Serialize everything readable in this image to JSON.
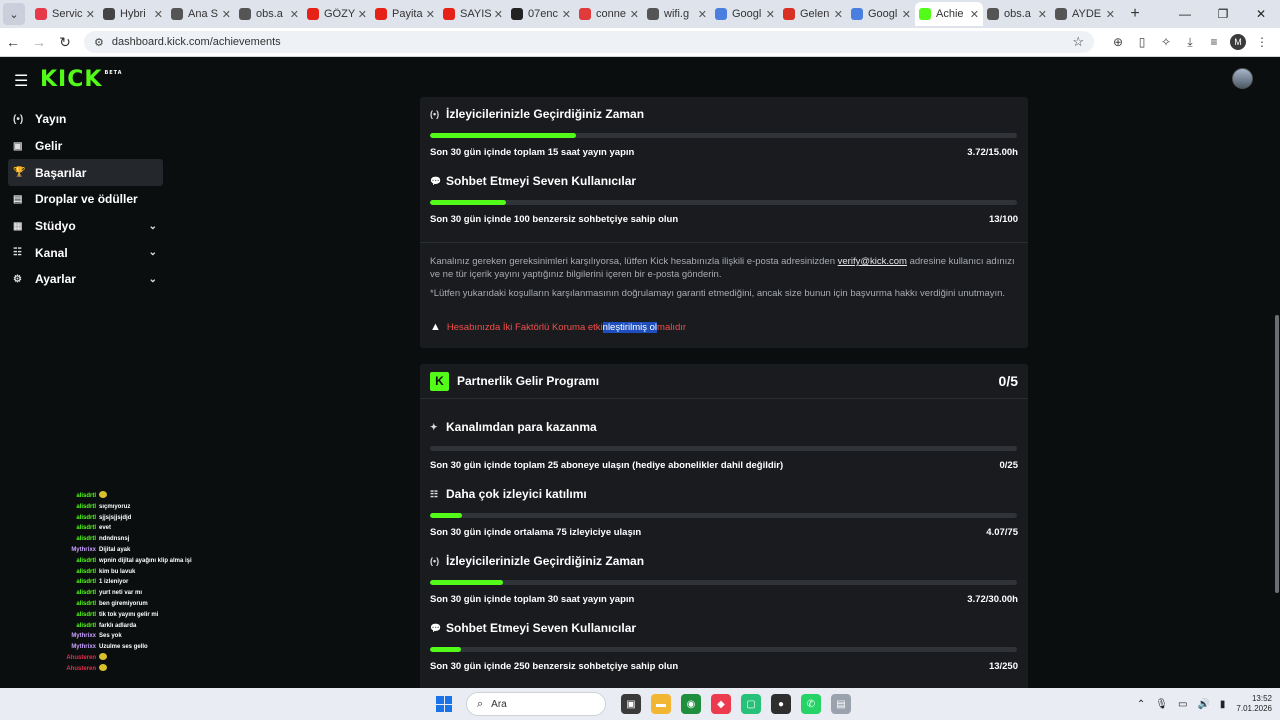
{
  "browser": {
    "tabs": [
      {
        "label": "Servic",
        "fav_color": "#e63a4a"
      },
      {
        "label": "Hybri",
        "fav_color": "#444444"
      },
      {
        "label": "Ana S",
        "fav_color": "#555555"
      },
      {
        "label": "obs.a",
        "fav_color": "#555555"
      },
      {
        "label": "GÖZY",
        "fav_color": "#e62117"
      },
      {
        "label": "Payita",
        "fav_color": "#e62117"
      },
      {
        "label": "SAYIS",
        "fav_color": "#e62117"
      },
      {
        "label": "07enc",
        "fav_color": "#222222"
      },
      {
        "label": "conne",
        "fav_color": "#e03a3a"
      },
      {
        "label": "wifi.g",
        "fav_color": "#555555"
      },
      {
        "label": "Googl",
        "fav_color": "#4a7fe0"
      },
      {
        "label": "Gelen",
        "fav_color": "#d93025"
      },
      {
        "label": "Googl",
        "fav_color": "#4a7fe0"
      },
      {
        "label": "Achie",
        "fav_color": "#53fc18",
        "active": true
      },
      {
        "label": "obs.a",
        "fav_color": "#555555"
      },
      {
        "label": "AYDE",
        "fav_color": "#555555"
      }
    ],
    "url": "dashboard.kick.com/achievements",
    "profile_initial": "M"
  },
  "header": {
    "logo": "KICK",
    "logo_badge": "BETA"
  },
  "sidebar": {
    "items": [
      {
        "label": "Yayın",
        "icon": "broadcast-icon",
        "glyph": "(•)"
      },
      {
        "label": "Gelir",
        "icon": "revenue-icon",
        "glyph": "▣"
      },
      {
        "label": "Başarılar",
        "icon": "trophy-icon",
        "glyph": "🏆",
        "active": true
      },
      {
        "label": "Droplar ve ödüller",
        "icon": "gift-icon",
        "glyph": "▤"
      },
      {
        "label": "Stüdyo",
        "icon": "studio-icon",
        "glyph": "▦",
        "chevron": true
      },
      {
        "label": "Kanal",
        "icon": "channel-icon",
        "glyph": "☷",
        "chevron": true
      },
      {
        "label": "Ayarlar",
        "icon": "gear-icon",
        "glyph": "⚙",
        "chevron": true
      }
    ]
  },
  "chat": {
    "lines": [
      {
        "user": "alisdrtl",
        "msg": "",
        "emoji": true,
        "color": "#53fc18"
      },
      {
        "user": "alisdrtl",
        "msg": "sıçmıyoruz",
        "color": "#53fc18"
      },
      {
        "user": "alisdrtl",
        "msg": "sjjsjsjjsjdjd",
        "color": "#53fc18"
      },
      {
        "user": "alisdrtl",
        "msg": "evet",
        "color": "#53fc18"
      },
      {
        "user": "alisdrtl",
        "msg": "ndndnsnsj",
        "color": "#53fc18"
      },
      {
        "user": "Mythrixx",
        "msg": "Dijital ayak",
        "color": "#c9a0ff"
      },
      {
        "user": "alisdrtl",
        "msg": "wpnin dijital ayağını klip alma işi",
        "color": "#53fc18"
      },
      {
        "user": "alisdrtl",
        "msg": "kim bu lavuk",
        "color": "#53fc18"
      },
      {
        "user": "alisdrtl",
        "msg": "1 izleniyor",
        "color": "#53fc18"
      },
      {
        "user": "alisdrtl",
        "msg": "yurt neti var mı",
        "color": "#53fc18"
      },
      {
        "user": "alisdrtl",
        "msg": "ben giremiyorum",
        "color": "#53fc18"
      },
      {
        "user": "alisdrtl",
        "msg": "tik tok yayını gelir mi",
        "color": "#53fc18"
      },
      {
        "user": "alisdrtl",
        "msg": "farklı adlarda",
        "color": "#53fc18"
      },
      {
        "user": "Mythrixx",
        "msg": "Ses yok",
        "color": "#c9a0ff"
      },
      {
        "user": "Mythrixx",
        "msg": "Uzulme ses gello",
        "color": "#c9a0ff"
      },
      {
        "user": "Ahusteren",
        "msg": "",
        "emoji": true,
        "color": "#e0304a"
      },
      {
        "user": "Ahusteren",
        "msg": "",
        "emoji": true,
        "color": "#e0304a"
      }
    ]
  },
  "panel1": {
    "metrics": [
      {
        "title": "İzleyicilerinizle Geçirdiğiniz Zaman",
        "icon": "broadcast-icon",
        "glyph": "(•)",
        "desc": "Son 30 gün içinde toplam 15 saat yayın yapın",
        "value": "3.72/15.00h",
        "fill_pct": 24.8
      },
      {
        "title": "Sohbet Etmeyi Seven Kullanıcılar",
        "icon": "chat-bubble-icon",
        "glyph": "💬",
        "desc": "Son 30 gün içinde 100 benzersiz sohbetçiye sahip olun",
        "value": "13/100",
        "fill_pct": 13
      }
    ],
    "info_part1": "Kanalınız gereken gereksinimleri karşılıyorsa, lütfen Kick hesabınızla ilişkili e-posta adresinizden ",
    "info_link": "verify@kick.com",
    "info_part2": " adresine kullanıcı adınızı ve ne tür içerik yayını yaptığınız bilgilerini içeren bir e-posta gönderin.",
    "note": "*Lütfen yukarıdaki koşulların karşılanmasının doğrulamayı garanti etmediğini, ancak size bunun için başvurma hakkı verdiğini unutmayın.",
    "warning_pre": "Hesabınızda İki Faktörlü Koruma etki",
    "warning_sel": "nleştirilmiş ol",
    "warning_post": "malıdır"
  },
  "panel2": {
    "title": "Partnerlik Gelir Programı",
    "count": "0/5",
    "badge": "K",
    "metrics": [
      {
        "title": "Kanalımdan para kazanma",
        "icon": "sparkle-icon",
        "glyph": "✦",
        "desc": "Son 30 gün içinde toplam 25 aboneye ulaşın (hediye abonelikler dahil değildir)",
        "value": "0/25",
        "fill_pct": 0
      },
      {
        "title": "Daha çok izleyici katılımı",
        "icon": "users-icon",
        "glyph": "☷",
        "desc": "Son 30 gün içinde ortalama 75 izleyiciye ulaşın",
        "value": "4.07/75",
        "fill_pct": 5.4
      },
      {
        "title": "İzleyicilerinizle Geçirdiğiniz Zaman",
        "icon": "broadcast-icon",
        "glyph": "(•)",
        "desc": "Son 30 gün içinde toplam 30 saat yayın yapın",
        "value": "3.72/30.00h",
        "fill_pct": 12.4
      },
      {
        "title": "Sohbet Etmeyi Seven Kullanıcılar",
        "icon": "chat-bubble-icon",
        "glyph": "💬",
        "desc": "Son 30 gün içinde 250 benzersiz sohbetçiye sahip olun",
        "value": "13/250",
        "fill_pct": 5.2
      }
    ]
  },
  "taskbar": {
    "search_placeholder": "Ara",
    "time": "13:52",
    "date": "7.01.2026"
  }
}
